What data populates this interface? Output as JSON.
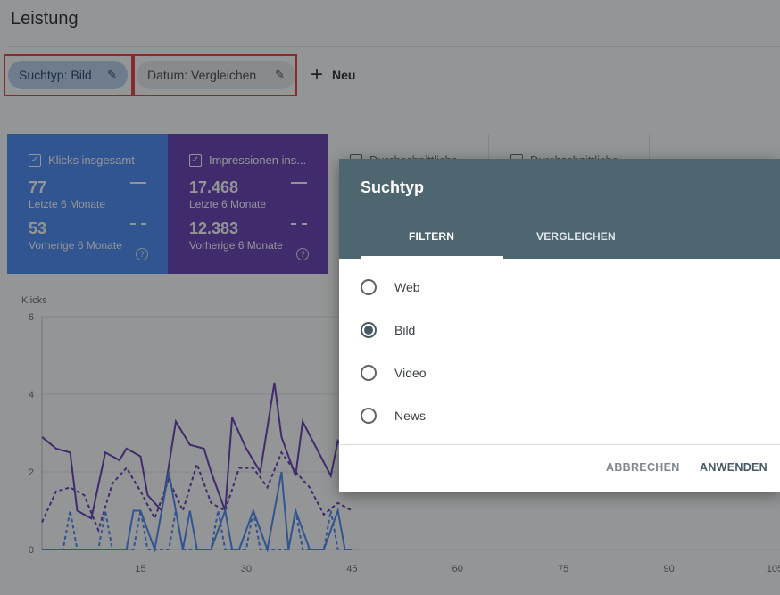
{
  "page": {
    "title": "Leistung"
  },
  "filters": {
    "chip1_label": "Suchtyp: Bild",
    "chip2_label": "Datum: Vergleichen",
    "new_label": "Neu"
  },
  "cards": {
    "clicks": {
      "label": "Klicks insgesamt",
      "value_current": "77",
      "label_current": "Letzte 6 Monate",
      "value_previous": "53",
      "label_previous": "Vorherige 6 Monate"
    },
    "impressions": {
      "label": "Impressionen ins...",
      "value_current": "17.468",
      "label_current": "Letzte 6 Monate",
      "value_previous": "12.383",
      "label_previous": "Vorherige 6 Monate"
    },
    "ctr": {
      "label": "Durchschnittliche..."
    },
    "position": {
      "label": "Durchschnittliche..."
    }
  },
  "dialog": {
    "title": "Suchtyp",
    "tabs": [
      "FILTERN",
      "VERGLEICHEN"
    ],
    "options": [
      {
        "label": "Web",
        "selected": false
      },
      {
        "label": "Bild",
        "selected": true
      },
      {
        "label": "Video",
        "selected": false
      },
      {
        "label": "News",
        "selected": false
      }
    ],
    "cancel_label": "ABBRECHEN",
    "apply_label": "ANWENDEN"
  },
  "colors": {
    "clicks": "#4285f4",
    "impressions": "#5e35b1",
    "dialog_header": "#4e6670"
  },
  "chart_data": {
    "type": "line",
    "ylabel": "Klicks",
    "ylim": [
      0,
      6
    ],
    "yticks": [
      "0",
      "2",
      "4",
      "6"
    ],
    "xlim": [
      1,
      105
    ],
    "xticks": [
      "15",
      "30",
      "45",
      "60",
      "75",
      "90",
      "105"
    ],
    "series": [
      {
        "style": "solid",
        "color": "#5e35b1",
        "x": [
          1,
          3,
          5,
          6,
          8,
          10,
          12,
          13,
          15,
          16,
          18,
          20,
          22,
          24,
          25,
          27,
          28,
          30,
          32,
          34,
          35,
          37,
          38,
          40,
          42,
          43,
          45
        ],
        "y": [
          2.9,
          2.6,
          2.5,
          1.0,
          0.8,
          2.5,
          2.3,
          2.6,
          2.4,
          1.4,
          1.0,
          3.3,
          2.7,
          2.6,
          2.0,
          1.0,
          3.4,
          2.6,
          2.0,
          4.3,
          2.9,
          1.9,
          3.3,
          2.6,
          1.9,
          2.8,
          2.3
        ]
      },
      {
        "style": "dashed",
        "color": "#5e35b1",
        "x": [
          1,
          3,
          5,
          7,
          9,
          11,
          13,
          15,
          17,
          19,
          21,
          23,
          25,
          27,
          29,
          31,
          33,
          35,
          37,
          39,
          41,
          43,
          45
        ],
        "y": [
          0.7,
          1.5,
          1.6,
          1.4,
          0.5,
          1.7,
          2.1,
          1.5,
          0.8,
          1.8,
          1.0,
          2.2,
          1.2,
          1.0,
          2.1,
          2.1,
          1.6,
          2.5,
          2.0,
          1.6,
          0.9,
          1.2,
          1.0
        ]
      },
      {
        "style": "solid",
        "color": "#4285f4",
        "x": [
          1,
          13,
          14,
          15,
          17,
          19,
          21,
          22,
          23,
          25,
          27,
          28,
          29,
          31,
          33,
          35,
          36,
          37,
          39,
          41,
          43,
          44,
          45
        ],
        "y": [
          0,
          0,
          1,
          1,
          0,
          2,
          0,
          1,
          0,
          0,
          1,
          0,
          0,
          1,
          0,
          2,
          0,
          1,
          0,
          0,
          1,
          0,
          0
        ]
      },
      {
        "style": "dashed",
        "color": "#4285f4",
        "x": [
          1,
          4,
          5,
          6,
          9,
          10,
          11,
          14,
          15,
          16,
          19,
          20,
          21,
          25,
          26,
          27,
          30,
          31,
          32,
          36,
          37,
          38,
          41,
          42,
          43
        ],
        "y": [
          0,
          0,
          1,
          0,
          0,
          1,
          0,
          0,
          1,
          0,
          0,
          1,
          0,
          0,
          1,
          0,
          0,
          1,
          0,
          0,
          1,
          0,
          0,
          1,
          0
        ]
      }
    ]
  }
}
